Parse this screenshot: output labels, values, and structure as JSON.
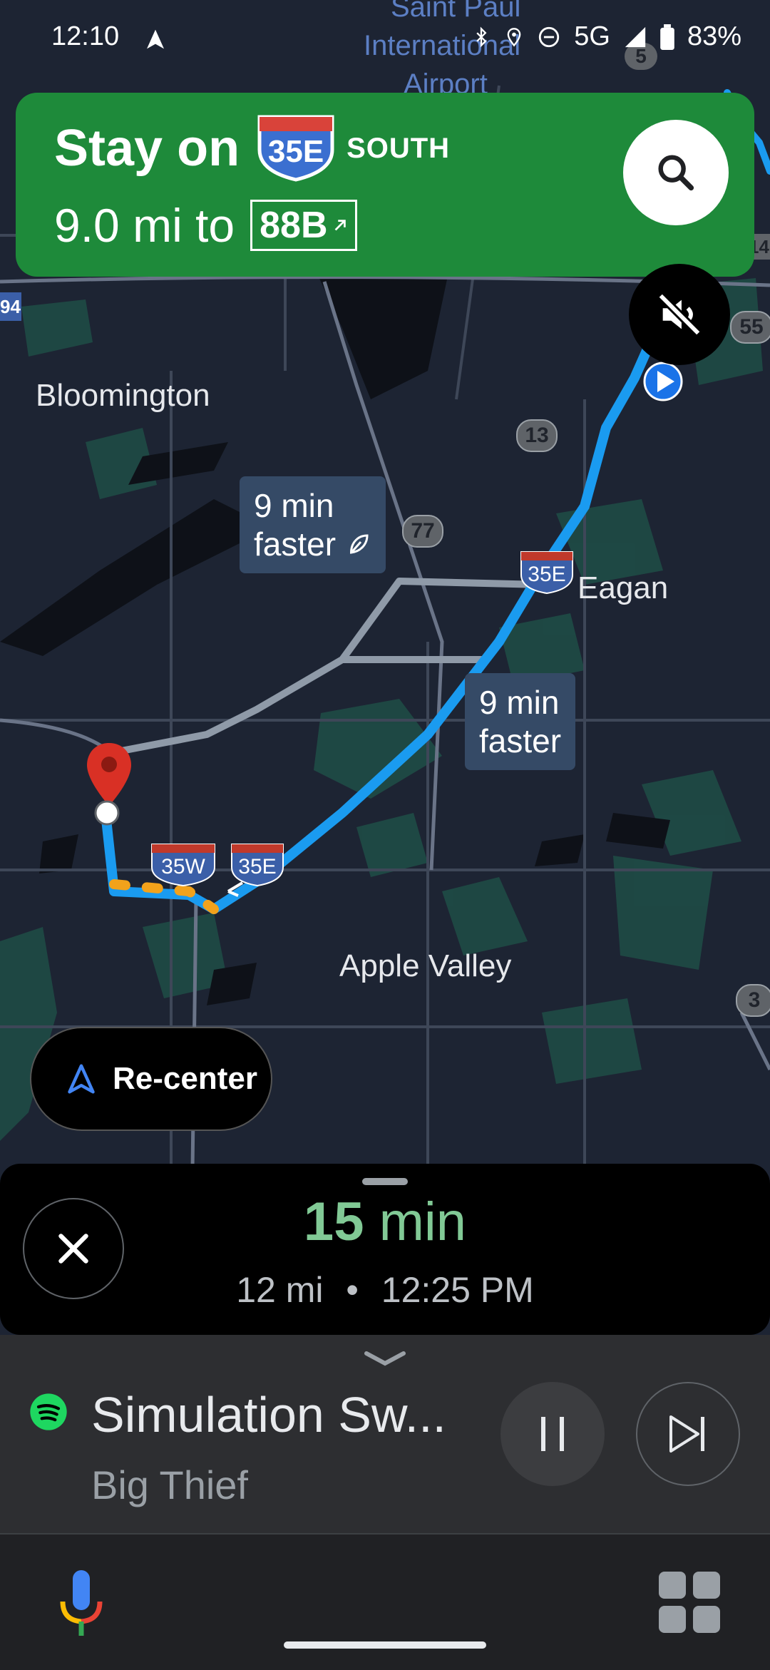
{
  "status_bar": {
    "time": "12:10",
    "network": "5G",
    "battery": "83%"
  },
  "map": {
    "labels": {
      "saint_paul": "Saint Paul",
      "international": "International",
      "airport": "Airport",
      "bloomington": "Bloomington",
      "eagan": "Eagan",
      "apple_valley": "Apple Valley"
    },
    "route_badges": {
      "r5": "5",
      "r13": "13",
      "r77": "77",
      "r55": "55",
      "r3": "3",
      "r14": "14",
      "r94": "94"
    },
    "interstate_badges": {
      "i35e_north": "35E",
      "i35w": "35W",
      "i35e_south": "35E"
    },
    "callouts": {
      "alt1_line1": "9 min",
      "alt1_line2": "faster",
      "alt2_line1": "9 min",
      "alt2_line2": "faster"
    },
    "colors": {
      "route": "#1a9bf0",
      "alt_route": "#8f9aa8",
      "traffic": "#f2a21b",
      "destination_pin": "#d93025"
    }
  },
  "banner": {
    "instruction": "Stay on",
    "highway": "35E",
    "direction": "SOUTH",
    "distance": "9.0 mi to",
    "exit": "88B",
    "color": "#1e8a3a"
  },
  "recenter": {
    "label": "Re-center"
  },
  "trip": {
    "duration_value": "15",
    "duration_unit": "min",
    "distance": "12 mi",
    "separator": "•",
    "arrival": "12:25 PM"
  },
  "media": {
    "song": "Simulation Sw...",
    "artist": "Big Thief"
  }
}
